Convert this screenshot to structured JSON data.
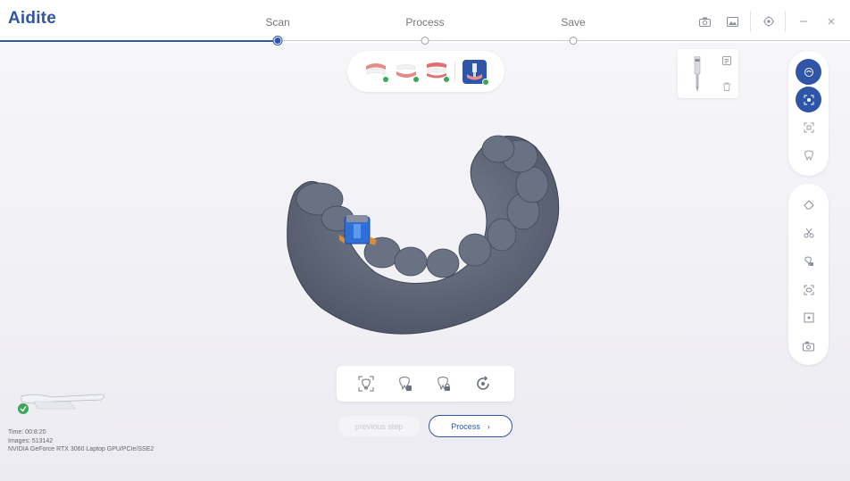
{
  "app": {
    "logo": "Aidite"
  },
  "steps": [
    {
      "label": "Scan",
      "active": true
    },
    {
      "label": "Process",
      "active": false
    },
    {
      "label": "Save",
      "active": false
    }
  ],
  "toolbar_icons": [
    "camera-icon",
    "image-icon",
    "settings-icon",
    "minimize-icon",
    "close-icon"
  ],
  "scan_types": [
    {
      "name": "upper-jaw",
      "done": true
    },
    {
      "name": "lower-jaw",
      "done": true
    },
    {
      "name": "bite",
      "done": true
    },
    {
      "name": "implant-scan-body",
      "active": true
    }
  ],
  "right_tools_top": [
    "scan-mode-icon",
    "scan-area-icon",
    "region-scan-icon",
    "tooth-scan-icon"
  ],
  "right_tools_bottom": [
    "eraser-icon",
    "scissors-icon",
    "tooth-lock-icon",
    "view-icon",
    "focus-icon",
    "snapshot-icon"
  ],
  "bottom_tools": [
    "fit-view-icon",
    "tooth-add-icon",
    "tooth-lock-icon",
    "reset-view-icon"
  ],
  "buttons": {
    "previous": "previous step",
    "process": "Process",
    "process_arrow": "›"
  },
  "status": {
    "time": "Time: 00:8:20",
    "images": "Images: 513142",
    "gpu": "NVIDIA GeForce RTX 3060 Laptop GPU/PCIe/SSE2"
  },
  "colors": {
    "accent": "#2f55a8",
    "success": "#3aa657",
    "model": "#5b6273"
  }
}
